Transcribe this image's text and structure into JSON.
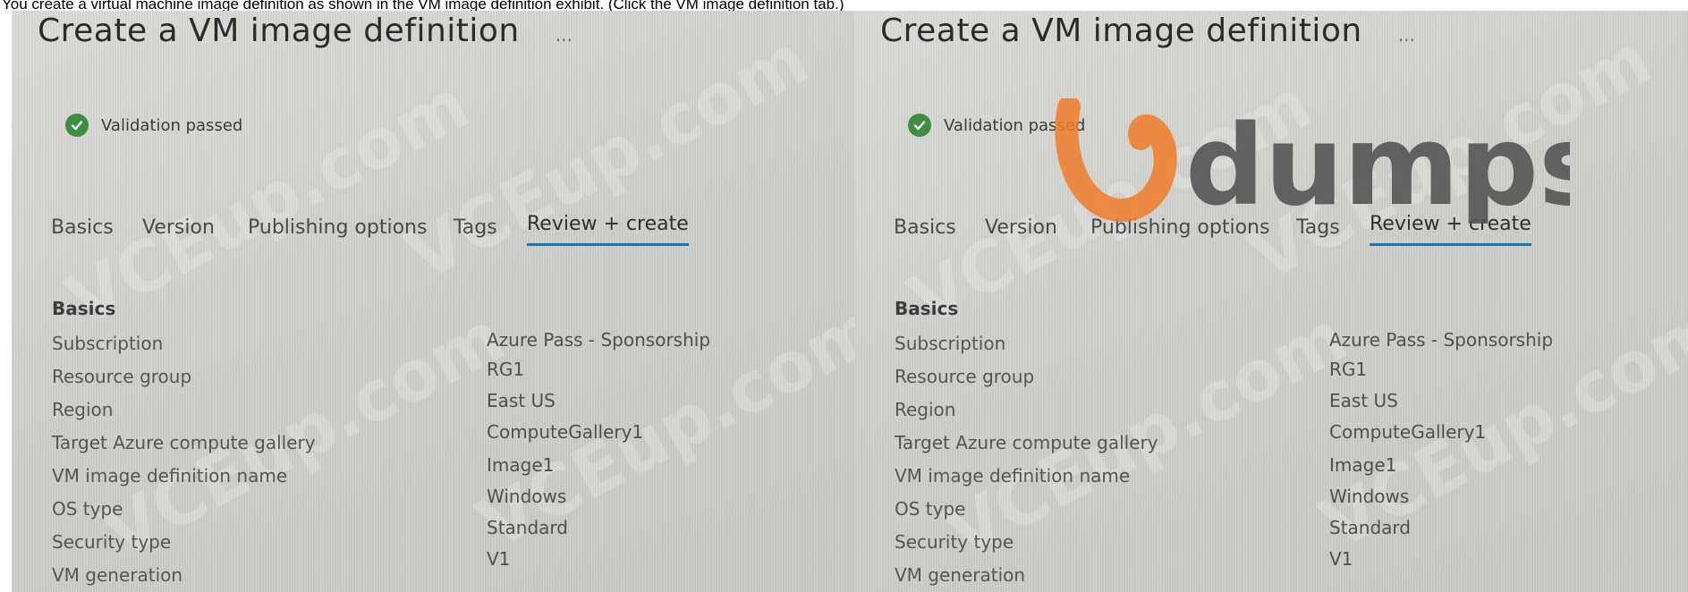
{
  "caption": "You create a virtual machine image definition as shown in the VM image definition exhibit. (Click the VM image definition tab.)",
  "panels": {
    "left": {
      "title": "Create a VM image definition",
      "more": "...",
      "validation": "Validation passed",
      "tabs": [
        "Basics",
        "Version",
        "Publishing options",
        "Tags",
        "Review + create"
      ],
      "section": "Basics",
      "rows": [
        {
          "label": "Subscription",
          "value": "Azure Pass - Sponsorship"
        },
        {
          "label": "Resource group",
          "value": "RG1"
        },
        {
          "label": "Region",
          "value": "East US"
        },
        {
          "label": "Target Azure compute gallery",
          "value": "ComputeGallery1"
        },
        {
          "label": "VM image definition name",
          "value": "Image1"
        },
        {
          "label": "OS type",
          "value": "Windows"
        },
        {
          "label": "Security type",
          "value": "Standard"
        },
        {
          "label": "VM generation",
          "value": "V1"
        }
      ]
    },
    "right": {
      "title": "Create a VM image definition",
      "more": "...",
      "validation": "Validation passed",
      "tabs": [
        "Basics",
        "Version",
        "Publishing options",
        "Tags",
        "Review + create"
      ],
      "section": "Basics",
      "rows": [
        {
          "label": "Subscription",
          "value": "Azure Pass - Sponsorship"
        },
        {
          "label": "Resource group",
          "value": "RG1"
        },
        {
          "label": "Region",
          "value": "East US"
        },
        {
          "label": "Target Azure compute gallery",
          "value": "ComputeGallery1"
        },
        {
          "label": "VM image definition name",
          "value": "Image1"
        },
        {
          "label": "OS type",
          "value": "Windows"
        },
        {
          "label": "Security type",
          "value": "Standard"
        },
        {
          "label": "VM generation",
          "value": "V1"
        }
      ]
    }
  },
  "watermark_text": "VCEup.com",
  "logo_text": "dumps",
  "colors": {
    "accent": "#2d6cab",
    "success": "#3e8e41",
    "logo_orange": "#f07d2a",
    "logo_gray": "#555555"
  }
}
